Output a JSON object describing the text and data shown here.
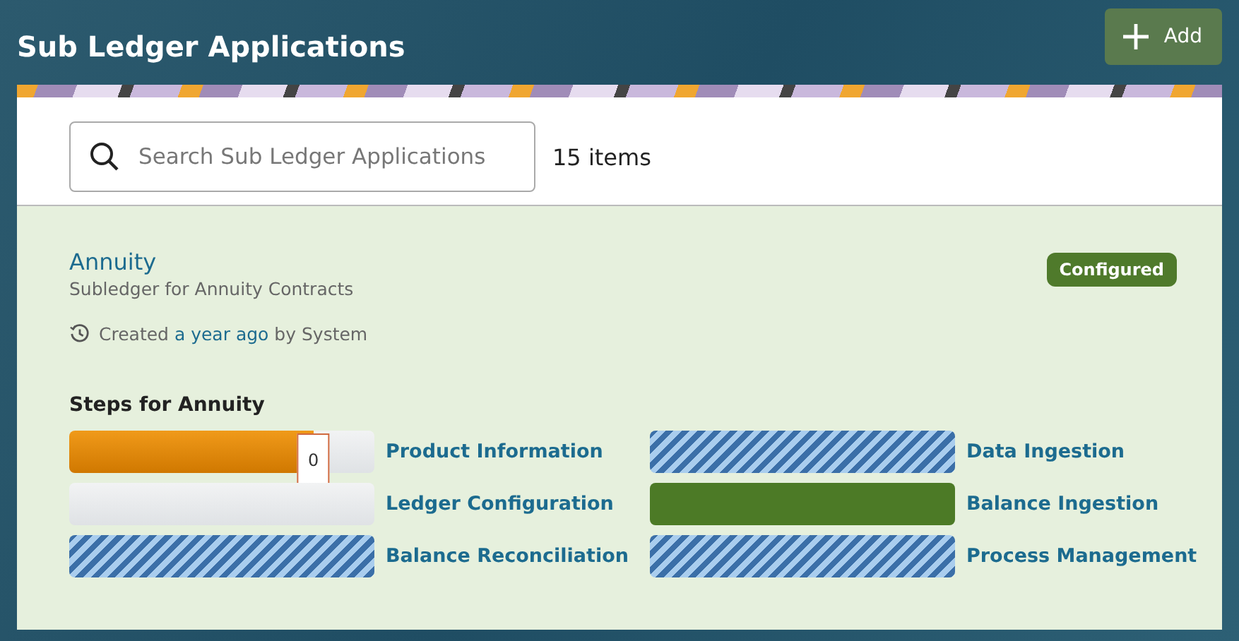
{
  "page": {
    "title": "Sub Ledger Applications",
    "add_button": "Add"
  },
  "search": {
    "placeholder": "Search Sub Ledger Applications",
    "count": "15 items"
  },
  "application": {
    "name": "Annuity",
    "description": "Subledger for Annuity Contracts",
    "created_prefix": "Created",
    "created_when": "a year ago",
    "created_suffix": "by System",
    "status": "Configured",
    "steps_title": "Steps for Annuity",
    "steps": [
      {
        "label": "Product Information",
        "kind": "in_progress",
        "level": 0.8,
        "badge": "0"
      },
      {
        "label": "Data Ingestion",
        "kind": "not_applicable"
      },
      {
        "label": "Ledger Configuration",
        "kind": "not_started"
      },
      {
        "label": "Balance Ingestion",
        "kind": "complete"
      },
      {
        "label": "Balance Reconciliation",
        "kind": "not_applicable"
      },
      {
        "label": "Process Management",
        "kind": "not_applicable"
      }
    ]
  }
}
